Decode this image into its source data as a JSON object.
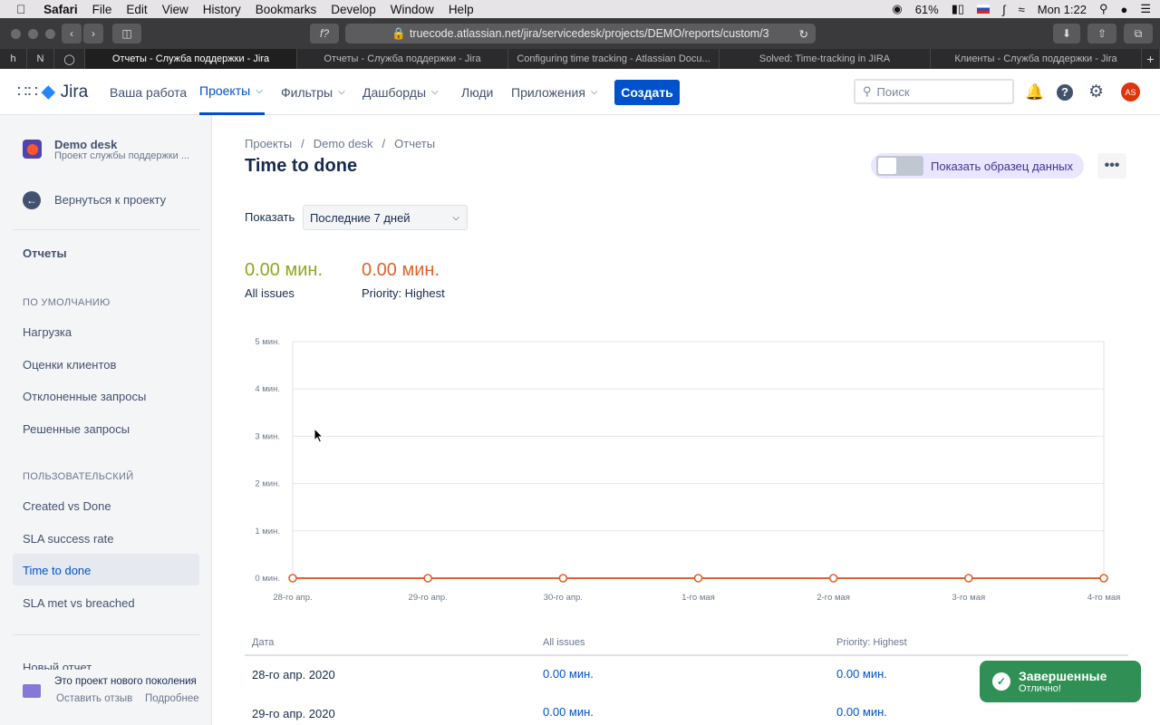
{
  "mac_menu": {
    "app": "Safari",
    "items": [
      "File",
      "Edit",
      "View",
      "History",
      "Bookmarks",
      "Develop",
      "Window",
      "Help"
    ],
    "battery": "61%",
    "clock": "Mon 1:22"
  },
  "browser": {
    "url": "truecode.atlassian.net/jira/servicedesk/projects/DEMO/reports/custom/3",
    "reader_label": "f?",
    "tabs": [
      {
        "label": "Отчеты - Служба поддержки - Jira",
        "active": true
      },
      {
        "label": "Отчеты - Служба поддержки - Jira",
        "active": false
      },
      {
        "label": "Configuring time tracking - Atlassian Docu...",
        "active": false
      },
      {
        "label": "Solved: Time-tracking in JIRA",
        "active": false
      },
      {
        "label": "Клиенты - Служба поддержки - Jira",
        "active": false
      }
    ],
    "fav_h": "h",
    "fav_n": "N"
  },
  "nav": {
    "logo": "Jira",
    "your_work": "Ваша работа",
    "projects": "Проекты",
    "filters": "Фильтры",
    "dashboards": "Дашборды",
    "people": "Люди",
    "apps": "Приложения",
    "create": "Создать",
    "search_placeholder": "Поиск",
    "avatar": "AS"
  },
  "sidebar": {
    "project_name": "Demo desk",
    "project_type": "Проект службы поддержки ...",
    "back": "Вернуться к проекту",
    "reports": "Отчеты",
    "default_section": "ПО УМОЛЧАНИЮ",
    "default_items": [
      "Нагрузка",
      "Оценки клиентов",
      "Отклоненные запросы",
      "Решенные запросы"
    ],
    "custom_section": "ПОЛЬЗОВАТЕЛЬСКИЙ",
    "custom_items": [
      "Created vs Done",
      "SLA success rate",
      "Time to done",
      "SLA met vs breached"
    ],
    "new_report": "Новый отчет",
    "footer_text": "Это проект нового поколения",
    "feedback": "Оставить отзыв",
    "more": "Подробнее"
  },
  "page": {
    "breadcrumbs": [
      "Проекты",
      "Demo desk",
      "Отчеты"
    ],
    "title": "Time to done",
    "sample_toggle": "Показать образец данных",
    "show_label": "Показать",
    "period": "Последние 7 дней",
    "metrics": [
      {
        "value": "0.00 мин.",
        "label": "All issues",
        "color": "#8fa61d"
      },
      {
        "value": "0.00 мин.",
        "label": "Priority: Highest",
        "color": "#e0622c"
      }
    ]
  },
  "chart_data": {
    "type": "line",
    "x": [
      "28-го апр.",
      "29-го апр.",
      "30-го апр.",
      "1-го мая",
      "2-го мая",
      "3-го мая",
      "4-го мая"
    ],
    "yticks": [
      "0 мин.",
      "1 мин.",
      "2 мин.",
      "3 мин.",
      "4 мин.",
      "5 мин."
    ],
    "ylim": [
      0,
      5
    ],
    "series": [
      {
        "values": [
          0,
          0,
          0,
          0,
          0,
          0,
          0
        ],
        "color": "#e0622c"
      }
    ],
    "grid": true
  },
  "table": {
    "headers": [
      "Дата",
      "All issues",
      "Priority: Highest"
    ],
    "rows": [
      [
        "28-го апр. 2020",
        "0.00 мин.",
        "0.00 мин."
      ],
      [
        "29-го апр. 2020",
        "0.00 мин.",
        "0.00 мин."
      ]
    ]
  },
  "toast": {
    "title": "Завершенные",
    "subtitle": "Отлично!"
  }
}
